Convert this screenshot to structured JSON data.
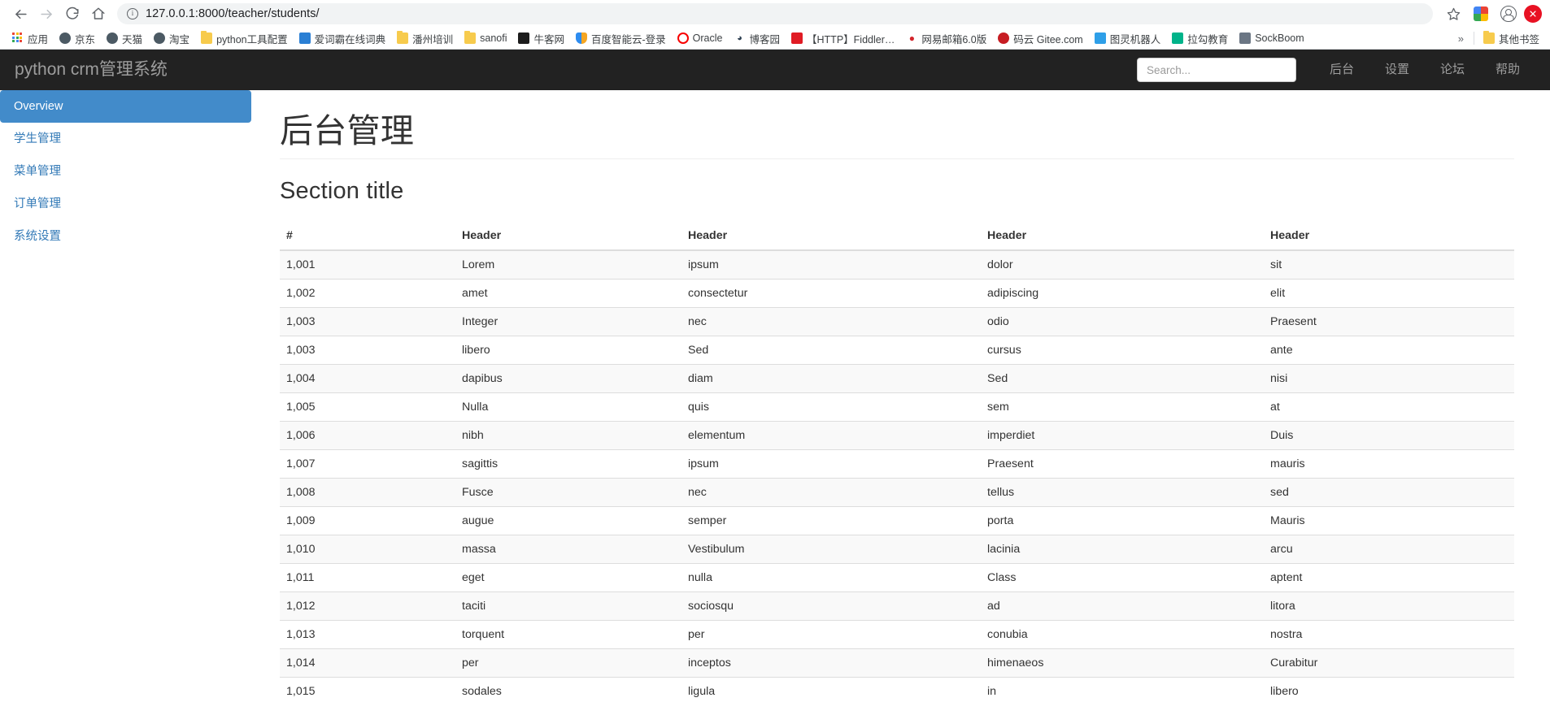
{
  "browser": {
    "url": "127.0.0.1:8000/teacher/students/",
    "back_icon": "back-arrow-icon",
    "forward_icon": "forward-arrow-icon",
    "reload_icon": "reload-icon",
    "home_icon": "home-icon",
    "site_info_icon": "site-info-icon",
    "bookmark_star_icon": "star-icon",
    "extension_icon": "extension-icon",
    "profile_icon": "profile-avatar-icon",
    "close_icon": "close-icon",
    "bookmarks": [
      {
        "label": "应用",
        "icon": "apps-grid-icon",
        "color": "#4285f4"
      },
      {
        "label": "京东",
        "icon": "globe-icon",
        "color": "#4c5a64"
      },
      {
        "label": "天猫",
        "icon": "globe-icon",
        "color": "#4c5a64"
      },
      {
        "label": "淘宝",
        "icon": "globe-icon",
        "color": "#4c5a64"
      },
      {
        "label": "python工具配置",
        "icon": "folder-icon",
        "color": "#f7cb4d"
      },
      {
        "label": "爱词霸在线词典",
        "icon": "iciba-icon",
        "color": "#2a7fd4"
      },
      {
        "label": "潘州培训",
        "icon": "folder-icon",
        "color": "#f7cb4d"
      },
      {
        "label": "sanofi",
        "icon": "folder-icon",
        "color": "#f7cb4d"
      },
      {
        "label": "牛客网",
        "icon": "nowcoder-icon",
        "color": "#1c1c1c"
      },
      {
        "label": "百度智能云-登录",
        "icon": "baidu-cloud-icon",
        "color": "#2d8cf0"
      },
      {
        "label": "Oracle",
        "icon": "oracle-icon",
        "color": "#f80000"
      },
      {
        "label": "博客园",
        "icon": "cnblogs-icon",
        "color": "#2c3e50"
      },
      {
        "label": "【HTTP】Fiddler…",
        "icon": "fiddler-icon",
        "color": "#e01b24"
      },
      {
        "label": "网易邮箱6.0版",
        "icon": "netease-mail-icon",
        "color": "#d3242b"
      },
      {
        "label": "码云 Gitee.com",
        "icon": "gitee-icon",
        "color": "#c71d23"
      },
      {
        "label": "图灵机器人",
        "icon": "turing-robot-icon",
        "color": "#2e9fe8"
      },
      {
        "label": "拉勾教育",
        "icon": "lagou-edu-icon",
        "color": "#00b38a"
      },
      {
        "label": "SockBoom",
        "icon": "sockboom-icon",
        "color": "#6b7684"
      }
    ],
    "overflow_label": "»",
    "other_bookmarks": {
      "label": "其他书签",
      "icon": "folder-icon"
    }
  },
  "app": {
    "brand": "python crm管理系统",
    "search": {
      "value": "",
      "placeholder": "Search..."
    },
    "nav_links": [
      {
        "label": "后台"
      },
      {
        "label": "设置"
      },
      {
        "label": "论坛"
      },
      {
        "label": "帮助"
      }
    ],
    "sidebar": {
      "items": [
        {
          "label": "Overview",
          "active": true
        },
        {
          "label": "学生管理",
          "active": false
        },
        {
          "label": "菜单管理",
          "active": false
        },
        {
          "label": "订单管理",
          "active": false
        },
        {
          "label": "系统设置",
          "active": false
        }
      ]
    },
    "main": {
      "page_title": "后台管理",
      "section_title": "Section title",
      "table": {
        "headers": [
          "#",
          "Header",
          "Header",
          "Header",
          "Header"
        ],
        "rows": [
          [
            "1,001",
            "Lorem",
            "ipsum",
            "dolor",
            "sit"
          ],
          [
            "1,002",
            "amet",
            "consectetur",
            "adipiscing",
            "elit"
          ],
          [
            "1,003",
            "Integer",
            "nec",
            "odio",
            "Praesent"
          ],
          [
            "1,003",
            "libero",
            "Sed",
            "cursus",
            "ante"
          ],
          [
            "1,004",
            "dapibus",
            "diam",
            "Sed",
            "nisi"
          ],
          [
            "1,005",
            "Nulla",
            "quis",
            "sem",
            "at"
          ],
          [
            "1,006",
            "nibh",
            "elementum",
            "imperdiet",
            "Duis"
          ],
          [
            "1,007",
            "sagittis",
            "ipsum",
            "Praesent",
            "mauris"
          ],
          [
            "1,008",
            "Fusce",
            "nec",
            "tellus",
            "sed"
          ],
          [
            "1,009",
            "augue",
            "semper",
            "porta",
            "Mauris"
          ],
          [
            "1,010",
            "massa",
            "Vestibulum",
            "lacinia",
            "arcu"
          ],
          [
            "1,011",
            "eget",
            "nulla",
            "Class",
            "aptent"
          ],
          [
            "1,012",
            "taciti",
            "sociosqu",
            "ad",
            "litora"
          ],
          [
            "1,013",
            "torquent",
            "per",
            "conubia",
            "nostra"
          ],
          [
            "1,014",
            "per",
            "inceptos",
            "himenaeos",
            "Curabitur"
          ],
          [
            "1,015",
            "sodales",
            "ligula",
            "in",
            "libero"
          ]
        ]
      }
    }
  },
  "colors": {
    "navbar_bg": "#222222",
    "sidebar_active": "#428bca",
    "link": "#337ab7",
    "close_red": "#e81123"
  }
}
